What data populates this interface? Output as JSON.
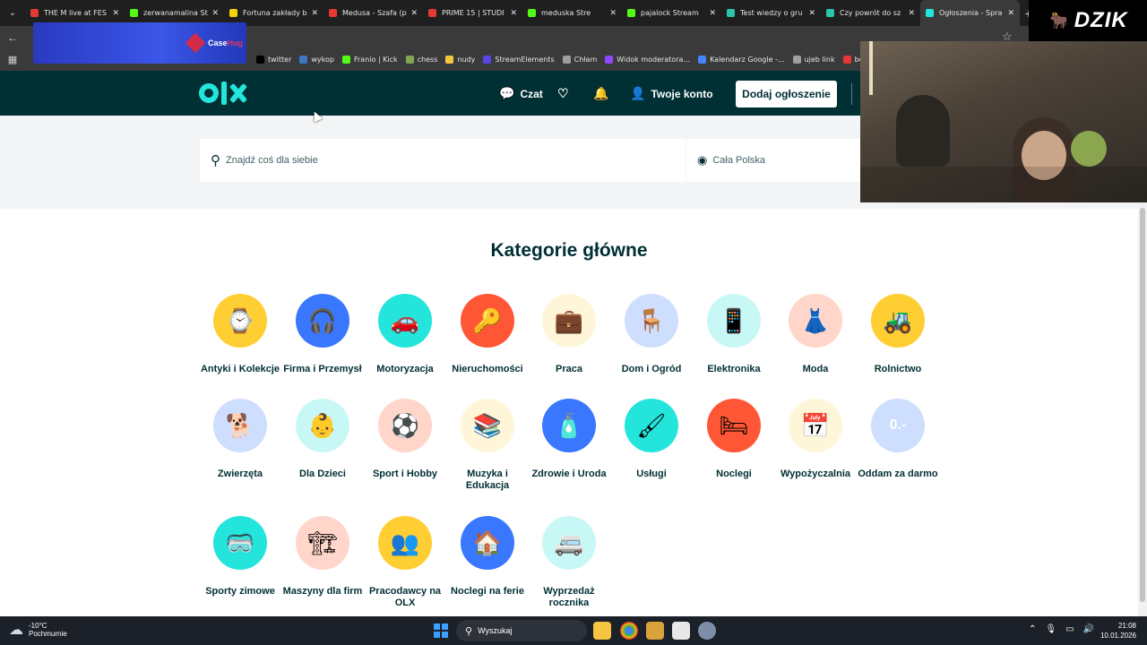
{
  "browser": {
    "tabs": [
      {
        "title": "THE M live at FES",
        "color": "#e53935"
      },
      {
        "title": "zerwanamalina St",
        "color": "#53fc18"
      },
      {
        "title": "Fortuna zakłady b",
        "color": "#f5d20a"
      },
      {
        "title": "Medusa - Szafa (p",
        "color": "#e53935"
      },
      {
        "title": "PRIME 15 | STUDI",
        "color": "#e53935"
      },
      {
        "title": "meduska Stre",
        "color": "#53fc18"
      },
      {
        "title": "pajalock Stream",
        "color": "#53fc18"
      },
      {
        "title": "Test wiedzy o gru",
        "color": "#2bc4a8"
      },
      {
        "title": "Czy powrót do sz",
        "color": "#2bc4a8"
      },
      {
        "title": "Ogłoszenia - Spra",
        "color": "#23e5db"
      }
    ],
    "bookmarks": [
      {
        "label": "twitter",
        "color": "#000000"
      },
      {
        "label": "wykop",
        "color": "#3c77c4"
      },
      {
        "label": "Franio | Kick",
        "color": "#53fc18"
      },
      {
        "label": "chess",
        "color": "#7fa650"
      },
      {
        "label": "nudy",
        "color": "#f5c542"
      },
      {
        "label": "StreamElements",
        "color": "#5a45e8"
      },
      {
        "label": "Chłam",
        "color": "#9e9e9e"
      },
      {
        "label": "Widok moderatora...",
        "color": "#9146ff"
      },
      {
        "label": "Kalendarz Google -...",
        "color": "#4285f4"
      },
      {
        "label": "ujeb link",
        "color": "#9e9e9e"
      },
      {
        "label": "be",
        "color": "#e53935"
      }
    ]
  },
  "overlay": {
    "stream_logo": "DZIK",
    "sponsor_prefix": "Case",
    "sponsor_suffix": "Hug"
  },
  "header": {
    "chat_label": "Czat",
    "account_label": "Twoje konto",
    "add_button": "Dodaj ogłoszenie"
  },
  "search": {
    "placeholder": "Znajdź coś dla siebie",
    "location": "Cała Polska"
  },
  "categories": {
    "title": "Kategorie główne",
    "items": [
      {
        "label": "Antyki i Kolekcje",
        "icon": "pocket-watch-icon",
        "glyph": "⌚",
        "bg": "#ffce32"
      },
      {
        "label": "Firma i Przemysł",
        "icon": "ear-protectors-icon",
        "glyph": "🎧",
        "bg": "#3a77ff"
      },
      {
        "label": "Motoryzacja",
        "icon": "car-icon",
        "glyph": "🚗",
        "bg": "#23e5db"
      },
      {
        "label": "Nieruchomości",
        "icon": "keys-icon",
        "glyph": "🔑",
        "bg": "#ff5636"
      },
      {
        "label": "Praca",
        "icon": "briefcase-icon",
        "glyph": "💼",
        "bg": "#fff6d9"
      },
      {
        "label": "Dom i Ogród",
        "icon": "armchair-icon",
        "glyph": "🪑",
        "bg": "#cedefe"
      },
      {
        "label": "Elektronika",
        "icon": "smartphone-icon",
        "glyph": "📱",
        "bg": "#c8f8f6"
      },
      {
        "label": "Moda",
        "icon": "dress-icon",
        "glyph": "👗",
        "bg": "#ffd6c9"
      },
      {
        "label": "Rolnictwo",
        "icon": "tractor-icon",
        "glyph": "🚜",
        "bg": "#ffce32"
      },
      {
        "label": "Zwierzęta",
        "icon": "dog-icon",
        "glyph": "🐕",
        "bg": "#cedefe"
      },
      {
        "label": "Dla Dzieci",
        "icon": "stroller-icon",
        "glyph": "👶",
        "bg": "#c8f8f6"
      },
      {
        "label": "Sport i Hobby",
        "icon": "football-icon",
        "glyph": "⚽",
        "bg": "#ffd6c9"
      },
      {
        "label": "Muzyka i Edukacja",
        "icon": "books-icon",
        "glyph": "📚",
        "bg": "#fff6d9"
      },
      {
        "label": "Zdrowie i Uroda",
        "icon": "perfume-icon",
        "glyph": "🧴",
        "bg": "#3a77ff"
      },
      {
        "label": "Usługi",
        "icon": "paint-roller-icon",
        "glyph": "🖌",
        "bg": "#23e5db"
      },
      {
        "label": "Noclegi",
        "icon": "bed-icon",
        "glyph": "🛏",
        "bg": "#ff5636"
      },
      {
        "label": "Wypożyczalnia",
        "icon": "calendar-icon",
        "glyph": "📅",
        "bg": "#fff6d9"
      },
      {
        "label": "Oddam za darmo",
        "icon": "zero-tag-icon",
        "glyph": "0.-",
        "bg": "#cedefe"
      },
      {
        "label": "Sporty zimowe",
        "icon": "ski-goggles-icon",
        "glyph": "🥽",
        "bg": "#23e5db"
      },
      {
        "label": "Maszyny dla firm",
        "icon": "excavator-arm-icon",
        "glyph": "🏗",
        "bg": "#ffd6c9"
      },
      {
        "label": "Pracodawcy na OLX",
        "icon": "employees-icon",
        "glyph": "👥",
        "bg": "#ffce32"
      },
      {
        "label": "Noclegi na ferie",
        "icon": "cabin-icon",
        "glyph": "🏠",
        "bg": "#3a77ff"
      },
      {
        "label": "Wyprzedaż rocznika",
        "icon": "van-icon",
        "glyph": "🚐",
        "bg": "#c8f8f6"
      }
    ]
  },
  "taskbar": {
    "temperature": "-10°C",
    "condition": "Pochmurnie",
    "search_label": "Wyszukaj",
    "time": "21:08",
    "date": "10.01.2026"
  }
}
